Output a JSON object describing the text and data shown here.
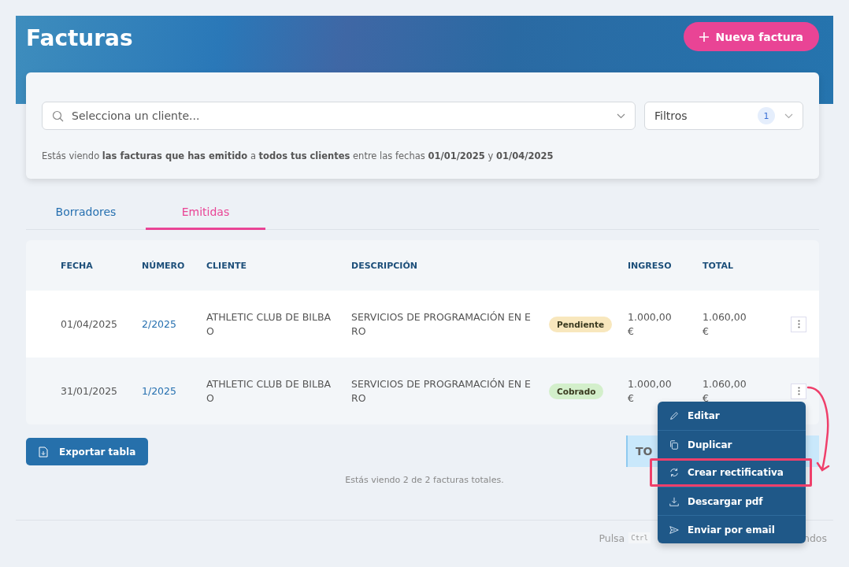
{
  "header": {
    "title": "Facturas",
    "new_button": "Nueva factura"
  },
  "filters": {
    "client_placeholder": "Selecciona un cliente...",
    "filters_label": "Filtros",
    "filters_count": "1",
    "summary": "Estás viendo **las facturas que has emitido** a **todos tus clientes** entre las fechas **01/01/2025** y **01/04/2025**"
  },
  "tabs": [
    {
      "label": "Borradores",
      "selected": false
    },
    {
      "label": "Emitidas",
      "selected": true
    }
  ],
  "table": {
    "columns": [
      "FECHA",
      "NÚMERO",
      "CLIENTE",
      "DESCRIPCIÓN",
      "",
      "INGRESO",
      "TOTAL"
    ],
    "rows": [
      {
        "fecha": "01/04/2025",
        "numero": "2/2025",
        "cliente": "ATHLETIC CLUB DE BILBAO",
        "descripcion": "SERVICIOS DE PROGRAMACIÓN EN ERO",
        "status": "Pendiente",
        "color": "#f8e7bd",
        "ingreso": "1.000,00 €",
        "total": "1.060,00 €"
      },
      {
        "fecha": "31/01/2025",
        "numero": "1/2025",
        "cliente": "ATHLETIC CLUB DE BILBAO",
        "descripcion": "SERVICIOS DE PROGRAMACIÓN EN ERO",
        "status": "Cobrado",
        "color": "#d3efcb",
        "ingreso": "1.000,00 €",
        "total": "1.060,00 €"
      }
    ]
  },
  "export_button": "Exportar tabla",
  "totals_box": "TO",
  "count_text": "Estás viendo 2 de 2 facturas totales.",
  "footer_hint": {
    "before": "Pulsa",
    "key": "Ctrl",
    "after": "ndos"
  },
  "menu": {
    "items": [
      {
        "kind": "edit",
        "label": "Editar",
        "highlighted": false
      },
      {
        "kind": "duplicate",
        "label": "Duplicar",
        "highlighted": false
      },
      {
        "kind": "refresh",
        "label": "Crear rectificativa",
        "highlighted": true
      },
      {
        "kind": "download",
        "label": "Descargar pdf",
        "highlighted": false
      },
      {
        "kind": "send",
        "label": "Enviar por email",
        "highlighted": false
      }
    ]
  }
}
